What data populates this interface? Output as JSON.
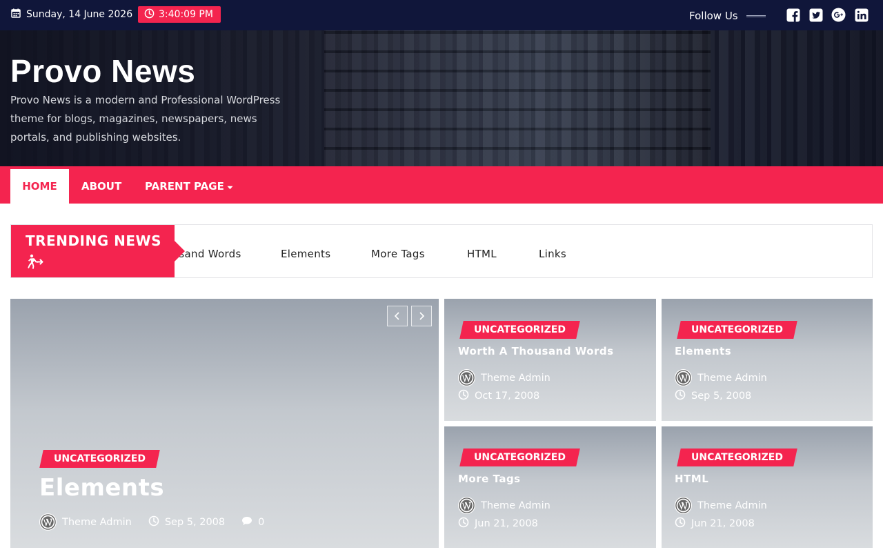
{
  "topbar": {
    "date": "Sunday, 14 June 2026",
    "time": "3:40:09 PM",
    "follow_label": "Follow Us",
    "social_icons": [
      "facebook-icon",
      "twitter-icon",
      "google-plus-icon",
      "linkedin-icon"
    ]
  },
  "header": {
    "site_title": "Provo News",
    "tagline": "Provo News is a modern and Professional WordPress theme for blogs, magazines, newspapers, news portals, and publishing websites."
  },
  "nav": {
    "items": [
      {
        "label": "HOME"
      },
      {
        "label": "ABOUT"
      },
      {
        "label": "PARENT PAGE"
      }
    ]
  },
  "trending": {
    "label": "TRENDING NEWS",
    "items": [
      "Worth A Thousand Words",
      "Elements",
      "More Tags",
      "HTML",
      "Links"
    ]
  },
  "featured": {
    "category": "UNCATEGORIZED",
    "title": "Elements",
    "author": "Theme Admin",
    "date": "Sep 5, 2008",
    "comments": "0"
  },
  "cards": [
    {
      "category": "UNCATEGORIZED",
      "title": "Worth A Thousand Words",
      "author": "Theme Admin",
      "date": "Oct 17, 2008"
    },
    {
      "category": "UNCATEGORIZED",
      "title": "Elements",
      "author": "Theme Admin",
      "date": "Sep 5, 2008"
    },
    {
      "category": "UNCATEGORIZED",
      "title": "More Tags",
      "author": "Theme Admin",
      "date": "Jun 21, 2008"
    },
    {
      "category": "UNCATEGORIZED",
      "title": "HTML",
      "author": "Theme Admin",
      "date": "Jun 21, 2008"
    }
  ],
  "colors": {
    "accent": "#f4244f",
    "topbar": "#10163a"
  }
}
